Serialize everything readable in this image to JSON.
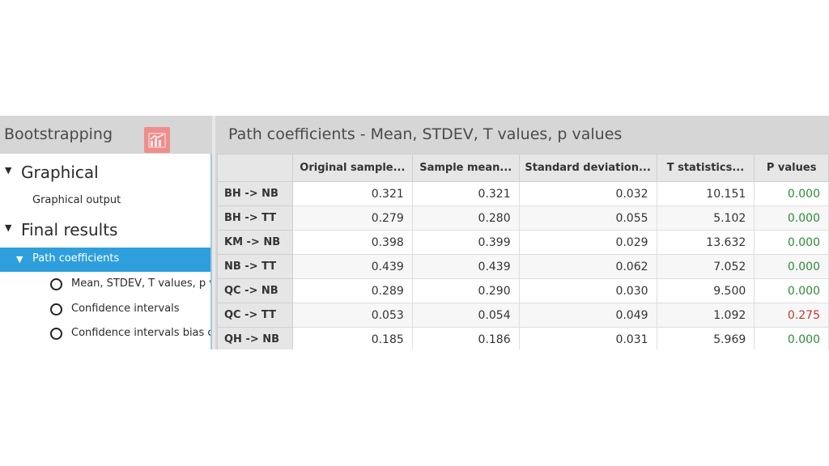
{
  "left_panel": {
    "title": "Bootstrapping",
    "tree": {
      "graphical_label": "Graphical",
      "graphical_output_label": "Graphical output",
      "final_results_label": "Final results",
      "path_coefficients_label": "Path coefficients",
      "sub_items": [
        "Mean, STDEV, T values, p v",
        "Confidence intervals",
        "Confidence intervals bias c"
      ]
    }
  },
  "right_panel": {
    "title": "Path coefficients - Mean, STDEV, T values, p values"
  },
  "table": {
    "columns": [
      "",
      "Original sample...",
      "Sample mean...",
      "Standard deviation...",
      "T statistics...",
      "P values"
    ],
    "rows": [
      {
        "path": "BH -> NB",
        "original": "0.321",
        "mean": "0.321",
        "stdev": "0.032",
        "t": "10.151",
        "p": "0.000",
        "significant": true
      },
      {
        "path": "BH -> TT",
        "original": "0.279",
        "mean": "0.280",
        "stdev": "0.055",
        "t": "5.102",
        "p": "0.000",
        "significant": true
      },
      {
        "path": "KM -> NB",
        "original": "0.398",
        "mean": "0.399",
        "stdev": "0.029",
        "t": "13.632",
        "p": "0.000",
        "significant": true
      },
      {
        "path": "NB -> TT",
        "original": "0.439",
        "mean": "0.439",
        "stdev": "0.062",
        "t": "7.052",
        "p": "0.000",
        "significant": true
      },
      {
        "path": "QC -> NB",
        "original": "0.289",
        "mean": "0.290",
        "stdev": "0.030",
        "t": "9.500",
        "p": "0.000",
        "significant": true
      },
      {
        "path": "QC -> TT",
        "original": "0.053",
        "mean": "0.054",
        "stdev": "0.049",
        "t": "1.092",
        "p": "0.275",
        "significant": false
      },
      {
        "path": "QH -> NB",
        "original": "0.185",
        "mean": "0.186",
        "stdev": "0.031",
        "t": "5.969",
        "p": "0.000",
        "significant": true
      }
    ]
  },
  "colors": {
    "selection": "#2e9fdc",
    "significant_p": "#2e8b3a",
    "nonsignificant_p": "#c0392b",
    "chart_icon_bg": "#ef8d8d"
  },
  "icons": {
    "chart_icon": "line-chart-icon",
    "expand_icon": "triangle-down-icon",
    "radio_icon": "radio-empty-icon"
  }
}
